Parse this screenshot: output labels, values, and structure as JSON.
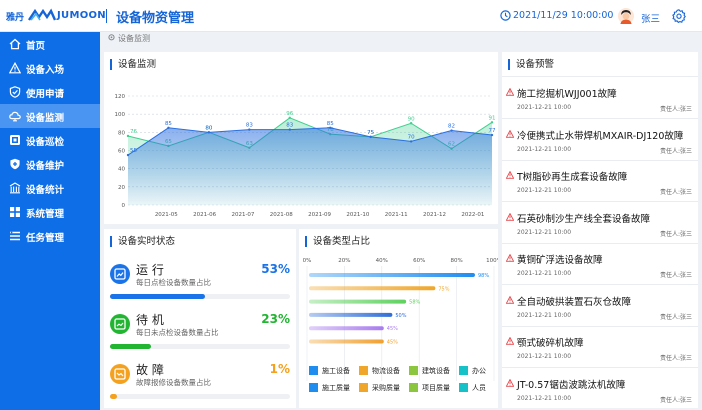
{
  "header": {
    "logo_cn": "雅丹",
    "logo_en": "JUMOON",
    "title": "设备物资管理",
    "datetime": "2021/11/29  10:00:00",
    "username": "张三"
  },
  "sidebar": {
    "items": [
      {
        "label": "首页",
        "icon": "home-icon"
      },
      {
        "label": "设备入场",
        "icon": "warning-icon"
      },
      {
        "label": "使用申请",
        "icon": "shield-check-icon"
      },
      {
        "label": "设备监测",
        "icon": "cloud-monitor-icon",
        "active": true
      },
      {
        "label": "设备巡检",
        "icon": "inspect-icon"
      },
      {
        "label": "设备维护",
        "icon": "shield-icon"
      },
      {
        "label": "设备统计",
        "icon": "building-icon"
      },
      {
        "label": "系统管理",
        "icon": "grid-icon"
      },
      {
        "label": "任务管理",
        "icon": "list-icon"
      }
    ]
  },
  "breadcrumb": "设备监测",
  "monitor": {
    "title": "设备监测"
  },
  "alerts": {
    "title": "设备预警",
    "items": [
      {
        "title": "施工挖掘机WJJ001故障",
        "date": "2021-12-21  10:00",
        "owner": "责任人:张三"
      },
      {
        "title": "冷便携式止水带焊机MXAIR-DJ120故障",
        "date": "2021-12-21  10:00",
        "owner": "责任人:张三"
      },
      {
        "title": "T树脂砂再生成套设备故障",
        "date": "2021-12-21  10:00",
        "owner": "责任人:张三"
      },
      {
        "title": "石英砂制沙生产线全套设备故障",
        "date": "2021-12-21  10:00",
        "owner": "责任人:张三"
      },
      {
        "title": "黄铜矿浮选设备故障",
        "date": "2021-12-21  10:00",
        "owner": "责任人:张三"
      },
      {
        "title": "全自动破拱装置石灰仓故障",
        "date": "2021-12-21  10:00",
        "owner": "责任人:张三"
      },
      {
        "title": "颚式破碎机故障",
        "date": "2021-12-21  10:00",
        "owner": "责任人:张三"
      },
      {
        "title": "JT-0.57锯齿波跳汰机故障",
        "date": "2021-12-21  10:00",
        "owner": "责任人:张三"
      }
    ]
  },
  "realtime": {
    "title": "设备实时状态",
    "stats": [
      {
        "name": "运 行",
        "desc": "每日点检设备数量占比",
        "pct_label": "53%",
        "fraction": 0.53,
        "color": "#1a73e8",
        "icon": "chart-up-icon"
      },
      {
        "name": "待 机",
        "desc": "每日未点检设备数量占比",
        "pct_label": "23%",
        "fraction": 0.23,
        "color": "#21b531",
        "icon": "chart-flat-icon"
      },
      {
        "name": "故 障",
        "desc": "故障报修设备数量占比",
        "pct_label": "1%",
        "fraction": 0.01,
        "color": "#f4a11f",
        "icon": "chart-down-icon"
      }
    ]
  },
  "chart_data": [
    {
      "type": "area",
      "title": "设备监测",
      "categories": [
        "2021-05",
        "2021-06",
        "2021-07",
        "2021-08",
        "2021-09",
        "2021-10",
        "2021-11",
        "2021-12",
        "2022-01"
      ],
      "ylim": [
        0,
        120
      ],
      "yticks": [
        0,
        20,
        40,
        60,
        80,
        100,
        120
      ],
      "grid": true,
      "series": [
        {
          "values": [
            76,
            65,
            80,
            63,
            96,
            78,
            75,
            90,
            62,
            91
          ],
          "color": "#3fcf8e"
        },
        {
          "values": [
            55,
            85,
            80,
            83,
            83,
            85,
            75,
            70,
            82,
            77
          ],
          "color": "#2a6fe0"
        }
      ]
    },
    {
      "type": "bar",
      "title": "设备类型占比",
      "xticks": [
        "0%",
        "20%",
        "40%",
        "60%",
        "80%",
        "100%"
      ],
      "xlim": [
        0,
        100
      ],
      "bars": [
        {
          "value": 98,
          "label": "98%",
          "color": "#1f8df0"
        },
        {
          "value": 75,
          "label": "75%",
          "color": "#f0a62a"
        },
        {
          "value": 58,
          "label": "58%",
          "color": "#5ed15e"
        },
        {
          "value": 50,
          "label": "50%",
          "color": "#2f6ed8"
        },
        {
          "value": 45,
          "label": "45%",
          "color": "#a87bf0"
        },
        {
          "value": 45,
          "label": "45%",
          "color": "#f0a030"
        }
      ],
      "legend": [
        {
          "label": "施工设备",
          "color": "#1f8df0"
        },
        {
          "label": "物流设备",
          "color": "#f0a62a"
        },
        {
          "label": "建筑设备",
          "color": "#8cc63f"
        },
        {
          "label": "办公",
          "color": "#17c1c8"
        },
        {
          "label": "施工质量",
          "color": "#1f8df0"
        },
        {
          "label": "采购质量",
          "color": "#f0a62a"
        },
        {
          "label": "项目质量",
          "color": "#8cc63f"
        },
        {
          "label": "人员",
          "color": "#17c1c8"
        }
      ]
    }
  ]
}
